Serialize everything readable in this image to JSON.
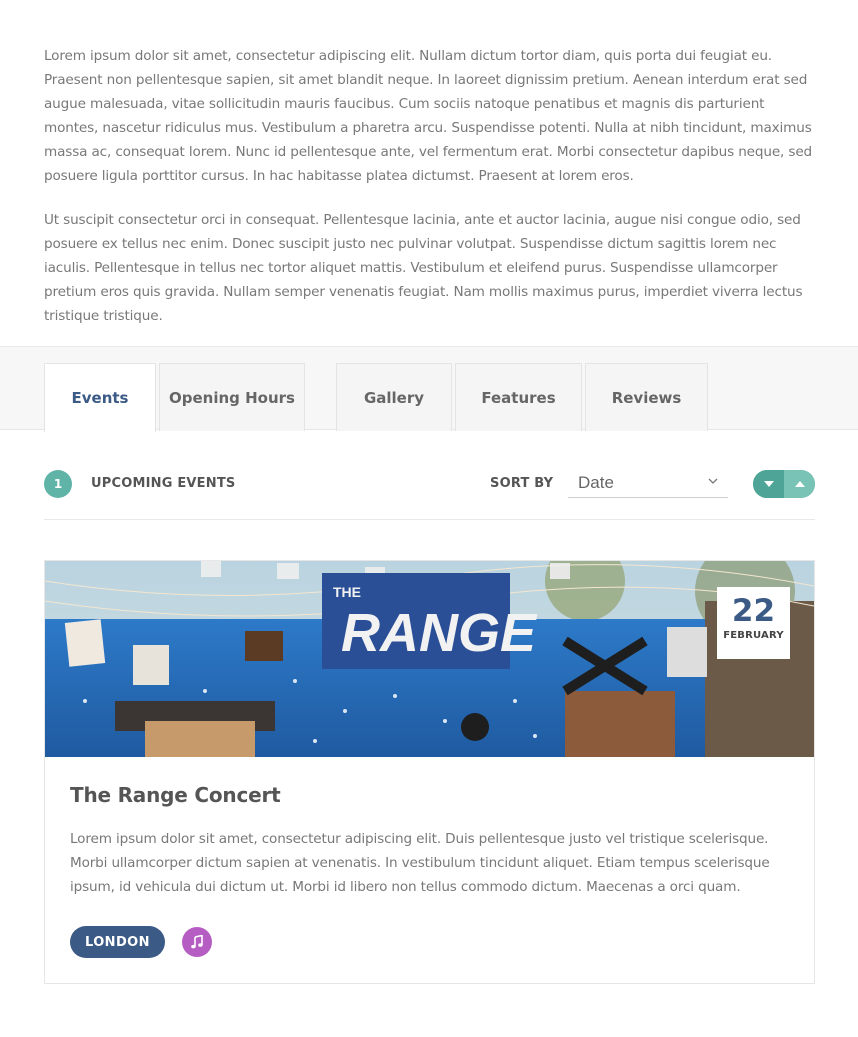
{
  "intro": {
    "paragraphs": [
      "Lorem ipsum dolor sit amet, consectetur adipiscing elit. Nullam dictum tortor diam, quis porta dui feugiat eu. Praesent non pellentesque sapien, sit amet blandit neque. In laoreet dignissim pretium. Aenean interdum erat sed augue malesuada, vitae sollicitudin mauris faucibus. Cum sociis natoque penatibus et magnis dis parturient montes, nascetur ridiculus mus. Vestibulum a pharetra arcu. Suspendisse potenti. Nulla at nibh tincidunt, maximus massa ac, consequat lorem. Nunc id pellentesque ante, vel fermentum erat. Morbi consectetur dapibus neque, sed posuere ligula porttitor cursus. In hac habitasse platea dictumst. Praesent at lorem eros.",
      "Ut suscipit consectetur orci in consequat. Pellentesque lacinia, ante et auctor lacinia, augue nisi congue odio, sed posuere ex tellus nec enim. Donec suscipit justo nec pulvinar volutpat. Suspendisse dictum sagittis lorem nec iaculis. Pellentesque in tellus nec tortor aliquet mattis. Vestibulum et eleifend purus. Suspendisse ullamcorper pretium eros quis gravida. Nullam semper venenatis feugiat. Nam mollis maximus purus, imperdiet viverra lectus tristique tristique."
    ]
  },
  "tabs": [
    {
      "label": "Events",
      "active": true
    },
    {
      "label": "Opening Hours",
      "active": false
    },
    {
      "label": "Gallery",
      "active": false
    },
    {
      "label": "Features",
      "active": false
    },
    {
      "label": "Reviews",
      "active": false
    }
  ],
  "toolbar": {
    "count": "1",
    "heading": "UPCOMING EVENTS",
    "sort_label": "SORT BY",
    "sort_value": "Date",
    "order_down_icon": "caret-down-icon",
    "order_up_icon": "caret-up-icon"
  },
  "event": {
    "image_text": "THE RANGE",
    "date_day": "22",
    "date_month": "FEBRUARY",
    "title": "The Range Concert",
    "description": "Lorem ipsum dolor sit amet, consectetur adipiscing elit. Duis pellentesque justo vel tristique scelerisque. Morbi ullamcorper dictum sapien at venenatis. In vestibulum tincidunt aliquet. Etiam tempus scelerisque ipsum, id vehicula dui dictum ut. Morbi id libero non tellus commodo dictum. Maecenas a orci quam.",
    "location": "LONDON",
    "category_icon": "music-note-icon"
  },
  "colors": {
    "accent_navy": "#3b5a86",
    "accent_teal": "#5fb4a7",
    "category_purple": "#b65dc3"
  }
}
